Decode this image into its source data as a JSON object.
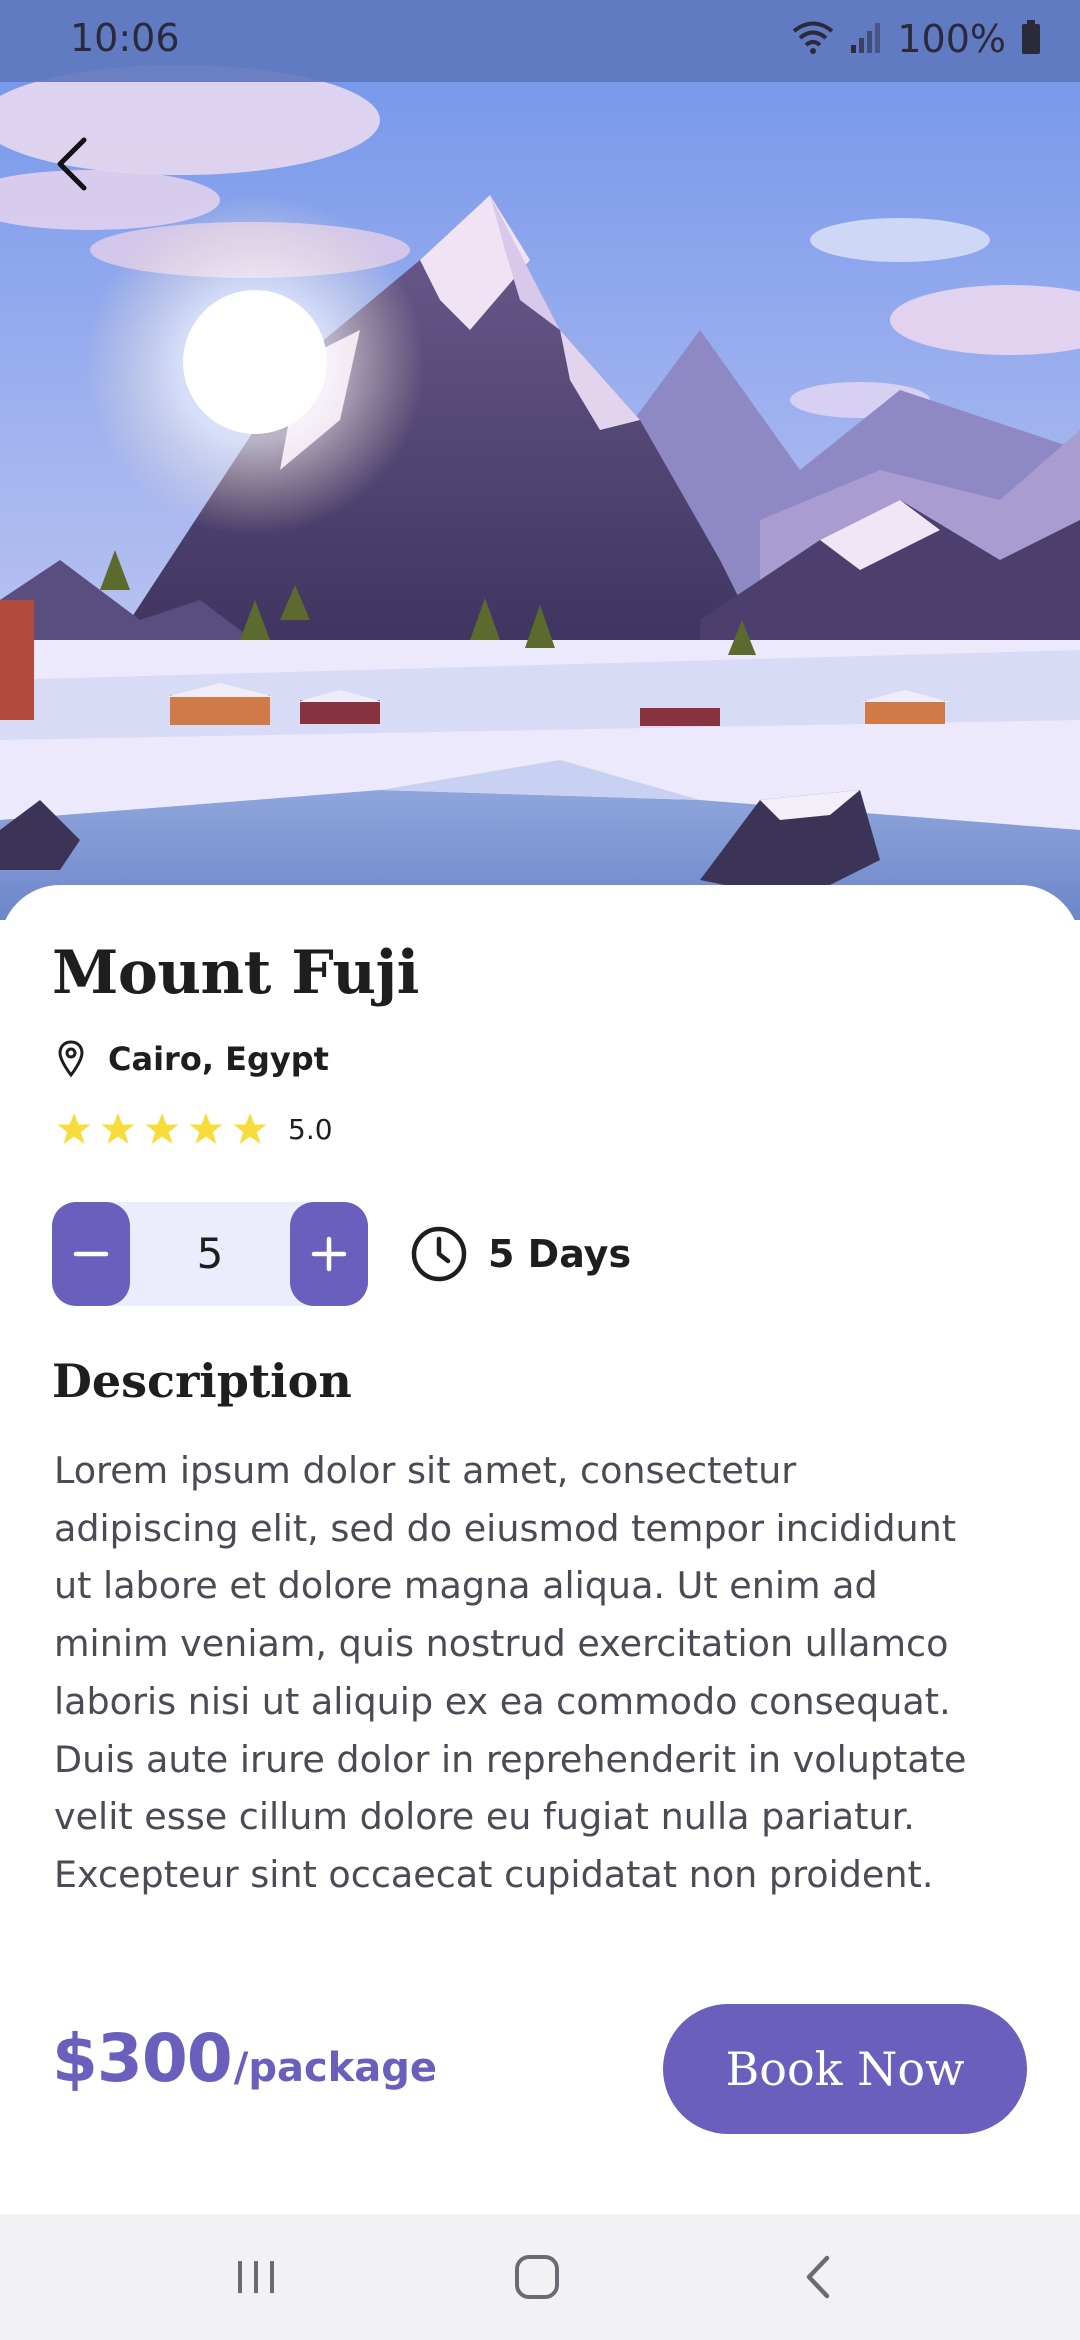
{
  "status_bar": {
    "time": "10:06",
    "battery": "100%",
    "icons": [
      "wifi-icon",
      "signal-icon",
      "battery-icon"
    ]
  },
  "hero": {
    "icon": "back-arrow-icon"
  },
  "destination": {
    "title": "Mount Fuji",
    "location": "Cairo, Egypt",
    "rating": 5.0,
    "rating_text": "5.0",
    "stars": 5
  },
  "booking": {
    "quantity": "5",
    "duration": "5 Days"
  },
  "description": {
    "heading": "Description",
    "lines": [
      "Lorem ipsum dolor sit amet, consectetur",
      "adipiscing elit, sed do eiusmod tempor incididunt",
      "ut labore et dolore magna aliqua. Ut enim ad",
      "minim veniam, quis nostrud exercitation ullamco",
      "laboris nisi ut aliquip ex ea commodo consequat.",
      "Duis aute irure dolor in reprehenderit in voluptate",
      "velit esse cillum dolore eu fugiat nulla pariatur.",
      "Excepteur sint occaecat cupidatat non proident."
    ]
  },
  "footer": {
    "price": "$300",
    "price_unit": "/package",
    "book_label": "Book Now"
  },
  "nav_bar": {
    "icons": [
      "recent-apps-icon",
      "home-icon",
      "back-icon"
    ]
  },
  "colors": {
    "accent": "#6a5fbd",
    "stepper_bg": "#ebecfc",
    "star": "#f8dc3a",
    "status_bar": "#6078be"
  }
}
